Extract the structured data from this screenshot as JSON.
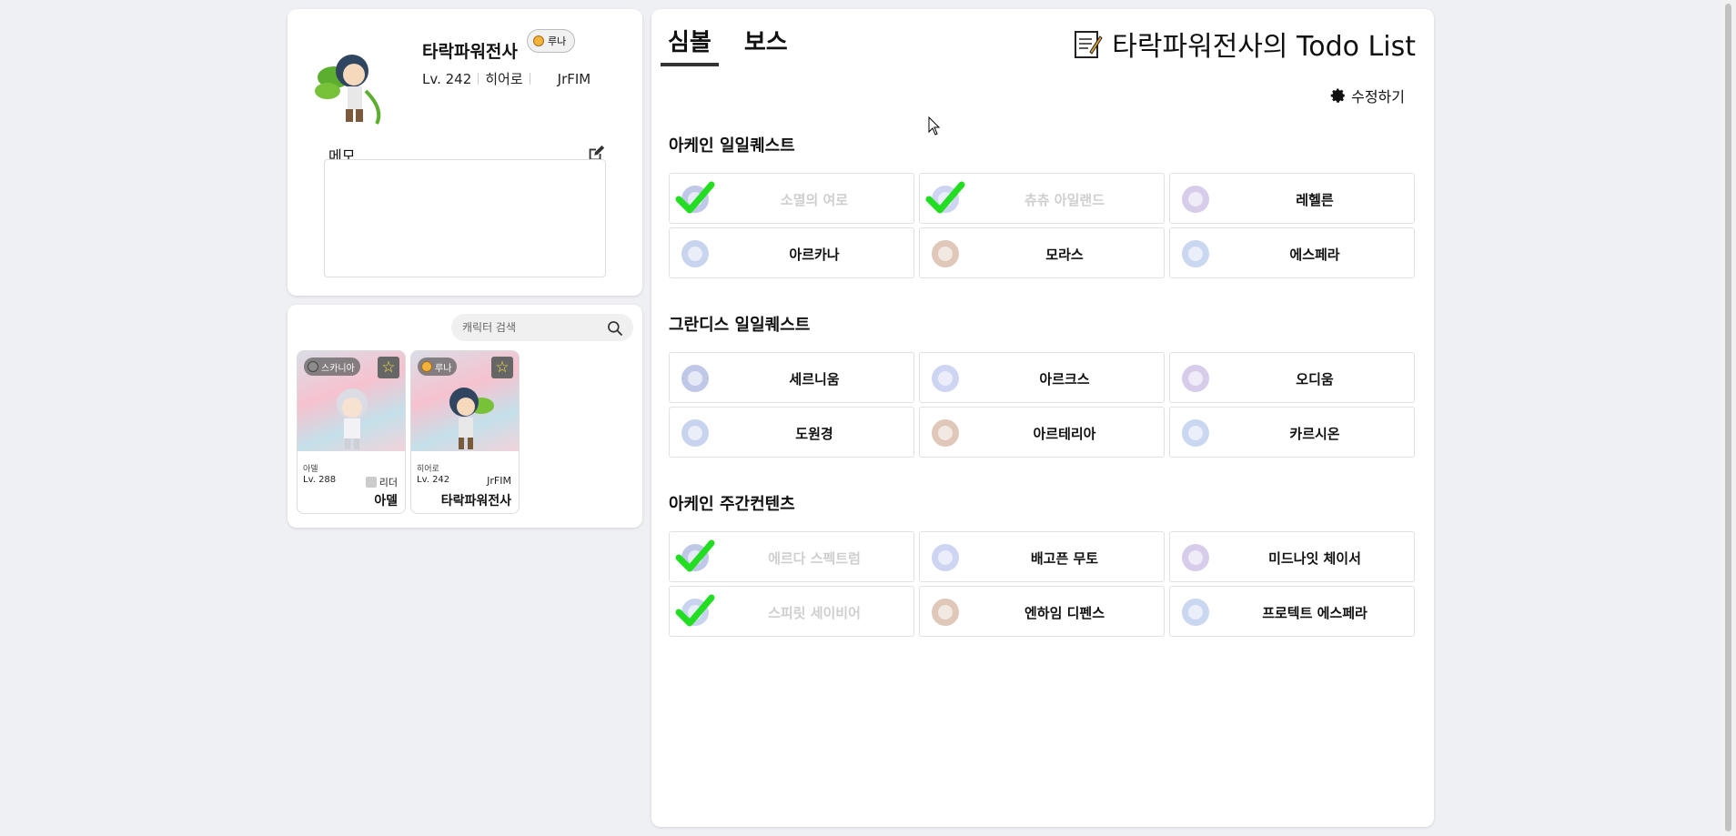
{
  "profile": {
    "name": "타락파워전사",
    "world": "루나",
    "level": "Lv. 242",
    "job": "히어로",
    "guild": "JrFIM",
    "memo_label": "메모",
    "memo_value": ""
  },
  "charlist": {
    "search_placeholder": "캐릭터 검색",
    "cards": [
      {
        "world": "스카니아",
        "job": "아델",
        "level": "Lv. 288",
        "extra": "리더",
        "name": "아델"
      },
      {
        "world": "루나",
        "job": "히어로",
        "level": "Lv. 242",
        "extra": "JrFIM",
        "name": "타락파워전사"
      }
    ]
  },
  "todo": {
    "tabs": [
      "심볼",
      "보스"
    ],
    "active_tab": "심볼",
    "title": "타락파워전사의 Todo List",
    "edit_label": "수정하기",
    "sections": [
      {
        "title": "아케인 일일퀘스트",
        "items": [
          {
            "label": "소멸의 여로",
            "done": true
          },
          {
            "label": "츄츄 아일랜드",
            "done": true
          },
          {
            "label": "레헬른",
            "done": false
          },
          {
            "label": "아르카나",
            "done": false
          },
          {
            "label": "모라스",
            "done": false
          },
          {
            "label": "에스페라",
            "done": false
          }
        ]
      },
      {
        "title": "그란디스 일일퀘스트",
        "items": [
          {
            "label": "세르니움",
            "done": false
          },
          {
            "label": "아르크스",
            "done": false
          },
          {
            "label": "오디움",
            "done": false
          },
          {
            "label": "도원경",
            "done": false
          },
          {
            "label": "아르테리아",
            "done": false
          },
          {
            "label": "카르시온",
            "done": false
          }
        ]
      },
      {
        "title": "아케인 주간컨텐츠",
        "items": [
          {
            "label": "에르다 스펙트럼",
            "done": true
          },
          {
            "label": "배고픈 무토",
            "done": false
          },
          {
            "label": "미드나잇 체이서",
            "done": false
          },
          {
            "label": "스피릿 세이비어",
            "done": true
          },
          {
            "label": "엔하임 디펜스",
            "done": false
          },
          {
            "label": "프로텍트 에스페라",
            "done": false
          }
        ]
      }
    ]
  },
  "colors": {
    "background": "#eff0f3",
    "panel": "#ffffff",
    "check": "#22dd22",
    "done_text": "#cfcfcf"
  }
}
